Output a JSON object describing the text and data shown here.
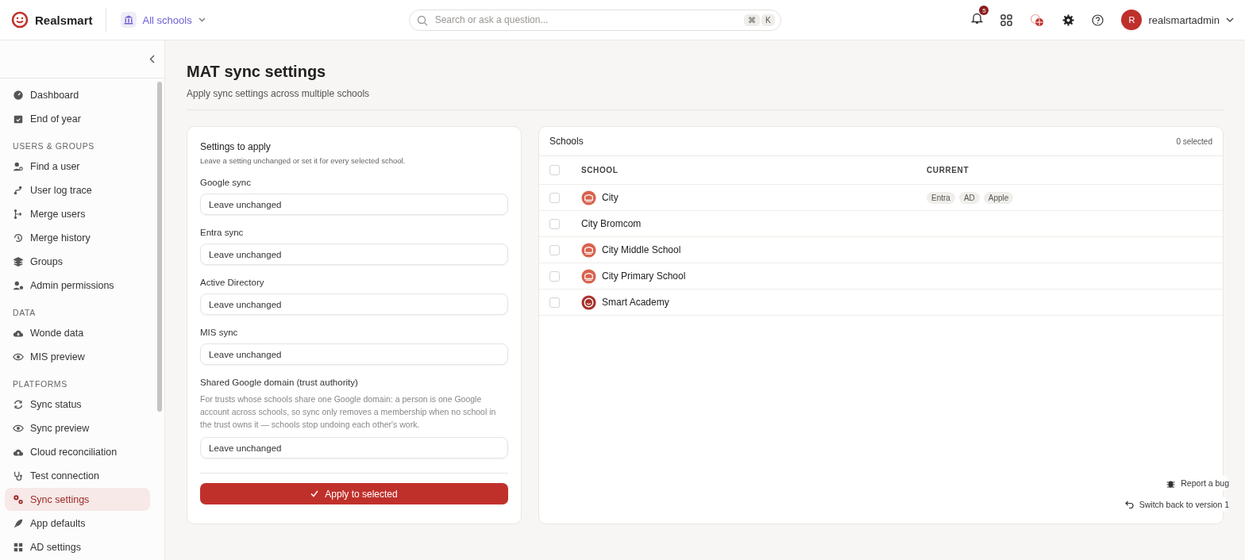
{
  "header": {
    "brand": "Realsmart",
    "school_picker": "All schools",
    "search": {
      "placeholder": "Search or ask a question...",
      "keys": [
        "⌘",
        "K"
      ]
    },
    "notifications": "5",
    "user": {
      "initial": "R",
      "name": "realsmartadmin"
    }
  },
  "sidebar": {
    "sections": [
      {
        "items": [
          {
            "label": "Dashboard",
            "selected": false
          },
          {
            "label": "End of year",
            "selected": false
          }
        ]
      },
      {
        "heading": "USERS & GROUPS",
        "items": [
          {
            "label": "Find a user",
            "selected": false
          },
          {
            "label": "User log trace",
            "selected": false
          },
          {
            "label": "Merge users",
            "selected": false
          },
          {
            "label": "Merge history",
            "selected": false
          },
          {
            "label": "Groups",
            "selected": false
          },
          {
            "label": "Admin permissions",
            "selected": false
          }
        ]
      },
      {
        "heading": "DATA",
        "items": [
          {
            "label": "Wonde data",
            "selected": false
          },
          {
            "label": "MIS preview",
            "selected": false
          }
        ]
      },
      {
        "heading": "PLATFORMS",
        "items": [
          {
            "label": "Sync status",
            "selected": false
          },
          {
            "label": "Sync preview",
            "selected": false
          },
          {
            "label": "Cloud reconciliation",
            "selected": false
          },
          {
            "label": "Test connection",
            "selected": false
          },
          {
            "label": "Sync settings",
            "selected": true
          },
          {
            "label": "App defaults",
            "selected": false
          },
          {
            "label": "AD settings",
            "selected": false
          }
        ]
      }
    ]
  },
  "page": {
    "title": "MAT sync settings",
    "subtitle": "Apply sync settings across multiple schools"
  },
  "settings": {
    "title": "Settings to apply",
    "hint": "Leave a setting unchanged or set it for every selected school.",
    "fields": [
      {
        "label": "Google sync",
        "value": "Leave unchanged"
      },
      {
        "label": "Entra sync",
        "value": "Leave unchanged"
      },
      {
        "label": "Active Directory",
        "value": "Leave unchanged"
      },
      {
        "label": "MIS sync",
        "value": "Leave unchanged"
      },
      {
        "label": "Shared Google domain (trust authority)",
        "description": "For trusts whose schools share one Google domain: a person is one Google account across schools, so sync only removes a membership when no school in the trust owns it — schools stop undoing each other's work.",
        "value": "Leave unchanged"
      }
    ],
    "apply_button": "Apply to selected"
  },
  "schools": {
    "title": "Schools",
    "selected_count": "0 selected",
    "all_checked": false,
    "columns": [
      "SCHOOL",
      "CURRENT"
    ],
    "rows": [
      {
        "name": "City",
        "kind": "crest",
        "checked": false,
        "current": [
          "Entra",
          "AD",
          "Apple"
        ]
      },
      {
        "name": "City Bromcom",
        "kind": "plain",
        "checked": false,
        "current": []
      },
      {
        "name": "City Middle School",
        "kind": "crest",
        "checked": false,
        "current": []
      },
      {
        "name": "City Primary School",
        "kind": "crest",
        "checked": false,
        "current": []
      },
      {
        "name": "Smart Academy",
        "kind": "smile",
        "checked": false,
        "current": []
      }
    ]
  },
  "floating": {
    "report_bug": "Report a bug",
    "switch_back": "Switch back to version 1"
  }
}
